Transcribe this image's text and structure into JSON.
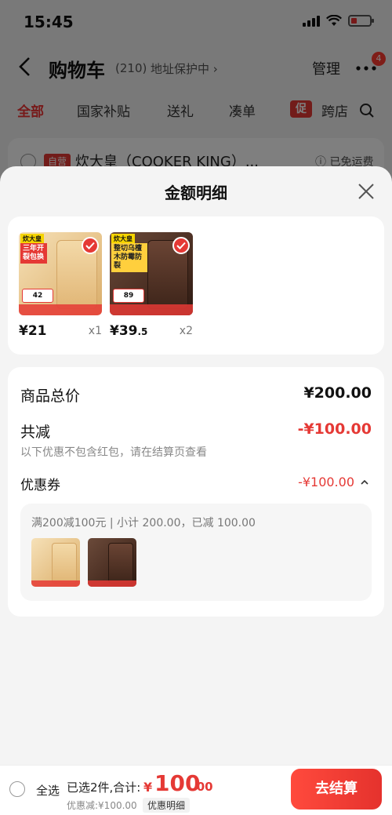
{
  "status_bar": {
    "time": "15:45"
  },
  "cart_header": {
    "title": "购物车",
    "count": "(210)",
    "address_protect": "地址保护中",
    "manage": "管理",
    "message_badge": "4"
  },
  "cart_tabs": [
    "全部",
    "国家补贴",
    "送礼",
    "凑单",
    "跨店"
  ],
  "promo_mark": "促",
  "shop_row": {
    "tag": "自营",
    "name": "炊大皇（COOKER KING）...",
    "shipping": "已免运费"
  },
  "sheet": {
    "title": "金额明细",
    "products": [
      {
        "brand": "炊大皇",
        "promo": "三年开裂包换",
        "chip": "42",
        "price": "¥21",
        "price_dec": "",
        "qty": "x1"
      },
      {
        "brand": "炊大皇",
        "promo": "整切乌檀木防霉防裂",
        "chip": "89",
        "price": "¥39",
        "price_dec": ".5",
        "qty": "x2"
      }
    ],
    "summary": {
      "goods_total_label": "商品总价",
      "goods_total_value": "¥200.00",
      "reduce_label": "共减",
      "reduce_value": "-¥100.00",
      "reduce_note": "以下优惠不包含红包，请在结算页查看",
      "coupon_label": "优惠券",
      "coupon_value": "-¥100.00",
      "coupon_rule": "满200减100元 | 小计 200.00，已减 100.00"
    }
  },
  "checkout": {
    "select_all": "全选",
    "selected_summary": "已选2件,合计:",
    "total_symbol": "¥",
    "total_int": "100",
    "total_dec": ".00",
    "discount_note": "优惠减:¥100.00",
    "detail_link": "优惠明细",
    "button": "去结算"
  },
  "colors": {
    "accent": "#e53935",
    "sheet_bg": "#f4f4f4"
  }
}
